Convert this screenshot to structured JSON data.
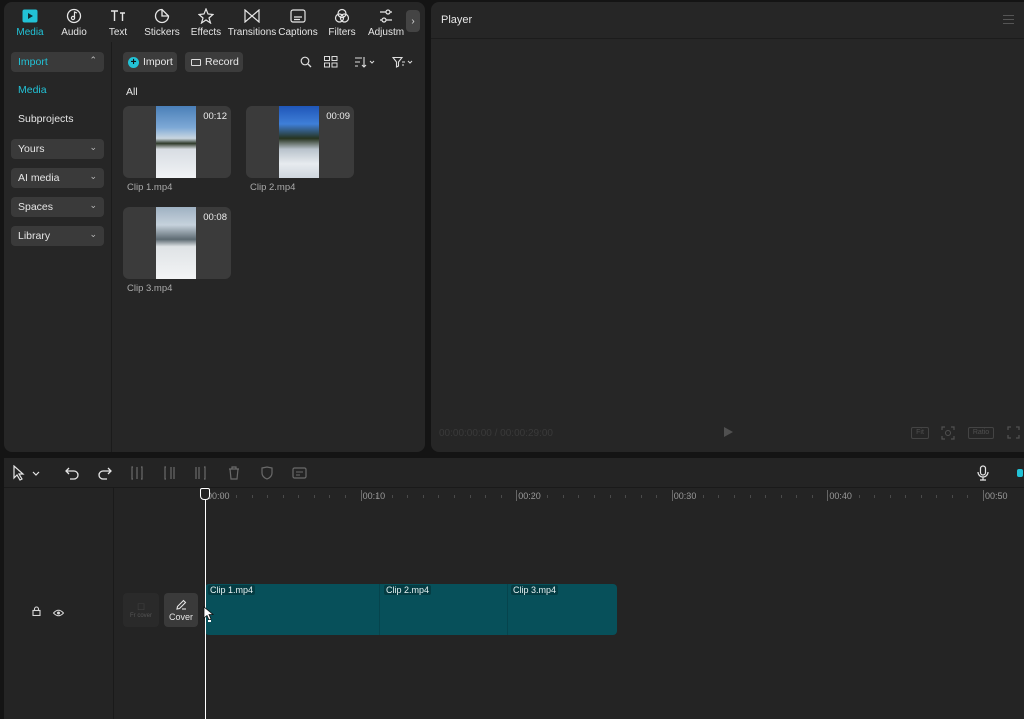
{
  "media_toolbar": {
    "tabs": [
      {
        "label": "Media",
        "icon": "media-icon"
      },
      {
        "label": "Audio",
        "icon": "audio-icon"
      },
      {
        "label": "Text",
        "icon": "text-icon"
      },
      {
        "label": "Stickers",
        "icon": "stickers-icon"
      },
      {
        "label": "Effects",
        "icon": "effects-icon"
      },
      {
        "label": "Transitions",
        "icon": "transitions-icon"
      },
      {
        "label": "Captions",
        "icon": "captions-icon"
      },
      {
        "label": "Filters",
        "icon": "filters-icon"
      },
      {
        "label": "Adjustm",
        "icon": "adjustment-icon"
      }
    ],
    "active_tab": "Media"
  },
  "sidebar": {
    "import_label": "Import",
    "media_label": "Media",
    "subprojects_label": "Subprojects",
    "yours_label": "Yours",
    "ai_media_label": "AI media",
    "spaces_label": "Spaces",
    "library_label": "Library"
  },
  "media": {
    "import_button": "Import",
    "record_button": "Record",
    "filter_label": "All",
    "clips": [
      {
        "name": "Clip 1.mp4",
        "duration": "00:12"
      },
      {
        "name": "Clip 2.mp4",
        "duration": "00:09"
      },
      {
        "name": "Clip 3.mp4",
        "duration": "00:08"
      }
    ]
  },
  "player": {
    "title": "Player",
    "time": "00:00:00:00 / 00:00:29:00",
    "fit_label": "Fit",
    "ratio_label": "Ratio"
  },
  "timeline": {
    "ruler_labels": [
      "00:00",
      "00:10",
      "00:20",
      "00:30",
      "00:40",
      "00:50"
    ],
    "cover_label": "Cover",
    "ghost_label": "Fr cover",
    "clips": [
      {
        "label": "Clip 1.mp4"
      },
      {
        "label": "Clip 2.mp4"
      },
      {
        "label": "Clip 3.mp4"
      }
    ]
  },
  "colors": {
    "accent": "#22c2d6",
    "clip_track": "#07505a",
    "panel": "#262626",
    "background": "#141414"
  }
}
